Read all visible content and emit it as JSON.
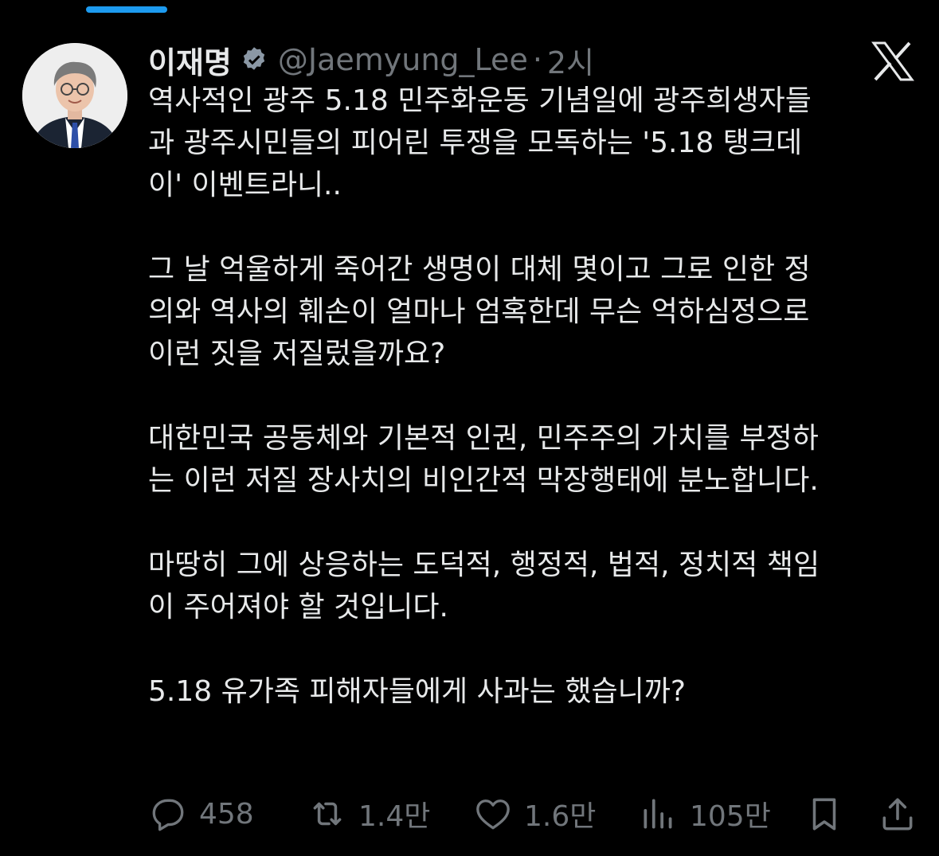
{
  "colors": {
    "background": "#000000",
    "text_primary": "#e7e9ea",
    "text_secondary": "#71767b",
    "accent": "#1d9bf0"
  },
  "author": {
    "display_name": "이재명",
    "handle": "@Jaemyung_Lee",
    "separator": "·",
    "time": "2시",
    "verified_icon": "verified-badge-icon",
    "avatar": "profile-photo"
  },
  "platform_icon": "x-logo-icon",
  "tweet": {
    "paragraphs": [
      "역사적인 광주 5.18 민주화운동 기념일에 광주희생자들\n과 광주시민들의 피어린 투쟁을 모독하는 '5.18 탱크데\n이' 이벤트라니..",
      "그 날 억울하게 죽어간 생명이 대체 몇이고 그로 인한 정\n의와 역사의 훼손이 얼마나 엄혹한데 무슨 억하심정으로\n이런 짓을 저질렀을까요?",
      "대한민국 공동체와 기본적 인권, 민주주의 가치를 부정하\n는 이런 저질 장사치의 비인간적 막장행태에 분노합니다.",
      "마땅히 그에 상응하는 도덕적, 행정적, 법적, 정치적 책임\n이 주어져야 할 것입니다.",
      "5.18 유가족 피해자들에게 사과는 했습니까?"
    ]
  },
  "actions": {
    "reply": {
      "icon": "reply-icon",
      "count": "458"
    },
    "repost": {
      "icon": "repost-icon",
      "count": "1.4만"
    },
    "like": {
      "icon": "heart-icon",
      "count": "1.6만"
    },
    "views": {
      "icon": "views-chart-icon",
      "count": "105만"
    },
    "bookmark": {
      "icon": "bookmark-icon"
    },
    "share": {
      "icon": "share-icon"
    }
  }
}
